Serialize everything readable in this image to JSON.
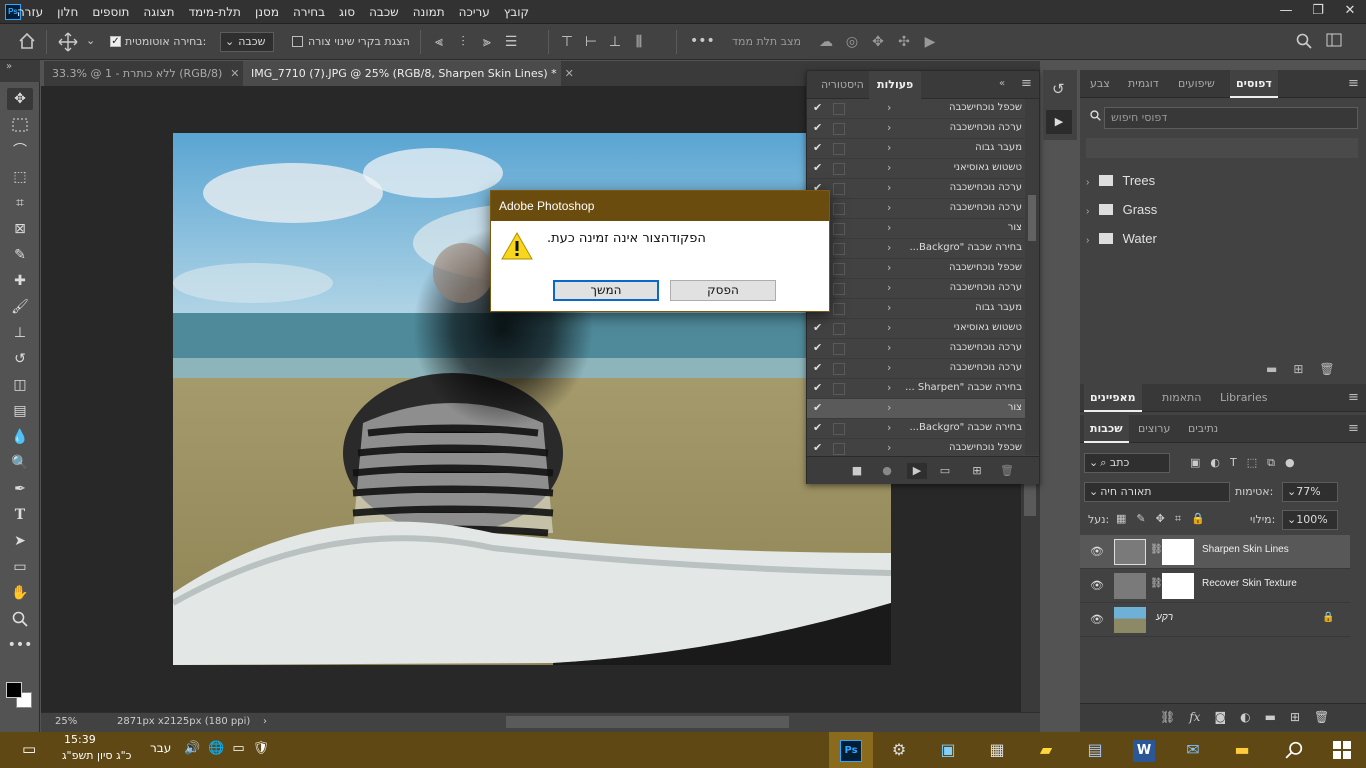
{
  "app": {
    "logo": "Ps",
    "menu": [
      "קובץ",
      "עריכה",
      "תמונה",
      "שכבה",
      "סוג",
      "בחירה",
      "מסנן",
      "תלת-מימד",
      "תצוגה",
      "תוספים",
      "חלון",
      "עזרה"
    ],
    "window_controls": [
      "—",
      "❐",
      "✕"
    ]
  },
  "options": {
    "auto_select_label": "בחירה אוטומטית:",
    "auto_select_checked": true,
    "target_select": "שכבה",
    "show_transform_label": "הצגת בקרי שינוי צורה",
    "show_transform_checked": false,
    "three_d_mode": "מצב תלת ממד"
  },
  "tabs": [
    {
      "label": "ללא כותרת - 1 @ 33.3% (RGB/8)",
      "close": "✕",
      "active": false
    },
    {
      "label": "IMG_7710 (7).JPG @ 25% (RGB/8, Sharpen Skin Lines) *",
      "close": "✕",
      "active": true
    }
  ],
  "status": {
    "zoom": "25%",
    "doc_info": "2871px x2125px (180 ppi)",
    "arrow": "›"
  },
  "actions_panel": {
    "tabs": [
      "פעולות",
      "היסטוריה"
    ],
    "items": [
      {
        "label": "שכפל נוכחישכבה",
        "checked": true,
        "selected": false
      },
      {
        "label": "ערכה נוכחישכבה",
        "checked": true,
        "selected": false
      },
      {
        "label": "מעבר גבוה",
        "checked": true,
        "selected": false
      },
      {
        "label": "טשטוש גאוסיאני",
        "checked": true,
        "selected": false
      },
      {
        "label": "ערכה נוכחישכבה",
        "checked": true,
        "selected": false
      },
      {
        "label": "ערכה נוכחישכבה",
        "checked": true,
        "selected": false
      },
      {
        "label": "צור",
        "checked": true,
        "selected": false
      },
      {
        "label": "בחירה שכבה \"Backgro...",
        "checked": true,
        "selected": false
      },
      {
        "label": "שכפל נוכחישכבה",
        "checked": true,
        "selected": false
      },
      {
        "label": "ערכה נוכחישכבה",
        "checked": true,
        "selected": false
      },
      {
        "label": "מעבר גבוה",
        "checked": true,
        "selected": false
      },
      {
        "label": "טשטוש גאוסיאני",
        "checked": true,
        "selected": false
      },
      {
        "label": "ערכה נוכחישכבה",
        "checked": true,
        "selected": false
      },
      {
        "label": "ערכה נוכחישכבה",
        "checked": true,
        "selected": false
      },
      {
        "label": "בחירה שכבה \"Sharpen ...",
        "checked": true,
        "selected": false
      },
      {
        "label": "צור",
        "checked": true,
        "selected": true
      },
      {
        "label": "בחירה שכבה \"Backgro...",
        "checked": true,
        "selected": false
      },
      {
        "label": "שכפל נוכחישכבה",
        "checked": true,
        "selected": false
      }
    ]
  },
  "patterns_panel": {
    "tabs": [
      "דפוסים",
      "שיפועים",
      "דוגמית",
      "צבע"
    ],
    "search_placeholder": "דפוסי חיפוש",
    "folders": [
      "Trees",
      "Grass",
      "Water"
    ]
  },
  "properties_tabs": [
    "מאפיינים",
    "התאמות",
    "Libraries"
  ],
  "layers_panel": {
    "tabs": [
      "שכבות",
      "ערוצים",
      "נתיבים"
    ],
    "filter": "כתב",
    "blend_mode": "תאורה חיה",
    "opacity_label": "אטימות:",
    "opacity": "77%",
    "lock_label": "נעל:",
    "fill_label": "מילוי:",
    "fill": "100%",
    "layers": [
      {
        "name": "Sharpen Skin Lines",
        "selected": true
      },
      {
        "name": "Recover Skin Texture",
        "selected": false
      },
      {
        "name": "רקע",
        "selected": false
      }
    ]
  },
  "dialog": {
    "title": "Adobe Photoshop",
    "message": "הפקודהצור אינה זמינה כעת.",
    "continue_label": "המשך",
    "stop_label": "הפסק"
  },
  "taskbar": {
    "time": "15:39",
    "date": "כ\"ג סיון תשפ\"ג",
    "language": "עבר"
  },
  "colors": {
    "dialog_title_bg": "#6b4c0f",
    "taskbar_bg": "#5f4813",
    "panel_bg": "#424242"
  }
}
